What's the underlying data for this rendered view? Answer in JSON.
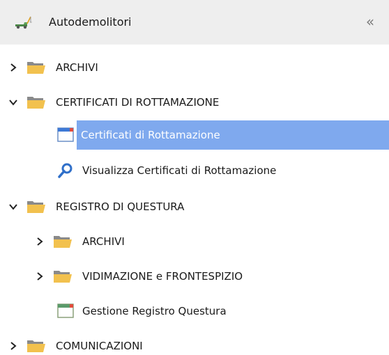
{
  "header": {
    "title": "Autodemolitori",
    "collapse_glyph": "«",
    "logo_icon": "tow-truck-icon",
    "collapse_icon": "double-chevron-left-icon"
  },
  "tree": {
    "archivi": {
      "label": "ARCHIVI",
      "expanded": false
    },
    "certificati": {
      "label": "CERTIFICATI DI ROTTAMAZIONE",
      "expanded": true,
      "children": {
        "certificati_rott": {
          "label": "Certificati di Rottamazione",
          "selected": true,
          "icon": "window-form-icon"
        },
        "visualizza": {
          "label": "Visualizza Certificati di Rottamazione",
          "icon": "search-icon"
        }
      }
    },
    "registro": {
      "label": "REGISTRO DI QUESTURA",
      "expanded": true,
      "children": {
        "archivi": {
          "label": "ARCHIVI",
          "expanded": false
        },
        "vidimazione": {
          "label": "VIDIMAZIONE e FRONTESPIZIO",
          "expanded": false
        },
        "gestione": {
          "label": "Gestione Registro Questura",
          "icon": "window-form-icon"
        }
      }
    },
    "comunicazioni": {
      "label": "COMUNICAZIONI",
      "expanded": false
    }
  },
  "colors": {
    "header_bg": "#eeeeee",
    "selection_bg": "#7fa9ee",
    "folder_yellow": "#f2c14e",
    "search_icon_blue": "#2f6fc9"
  }
}
